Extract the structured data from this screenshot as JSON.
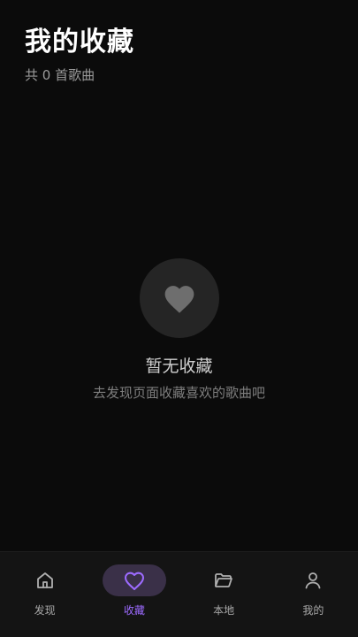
{
  "header": {
    "title": "我的收藏",
    "subtitle": "共 0 首歌曲"
  },
  "empty_state": {
    "icon": "heart-icon",
    "title": "暂无收藏",
    "hint": "去发现页面收藏喜欢的歌曲吧"
  },
  "tabs": [
    {
      "label": "发现",
      "icon": "home-icon",
      "active": false
    },
    {
      "label": "收藏",
      "icon": "heart-outline-icon",
      "active": true
    },
    {
      "label": "本地",
      "icon": "folder-icon",
      "active": false
    },
    {
      "label": "我的",
      "icon": "user-icon",
      "active": false
    }
  ],
  "colors": {
    "background": "#0b0b0b",
    "tabbar": "#141414",
    "accent": "#9d6bff",
    "active_pill": "#3a3048",
    "empty_circle": "#252525"
  }
}
